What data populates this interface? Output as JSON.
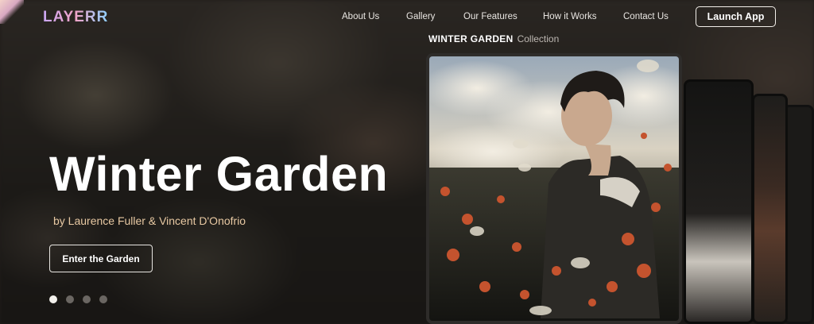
{
  "nav": {
    "logo": "LAYERR",
    "links": [
      "About Us",
      "Gallery",
      "Our Features",
      "How it Works",
      "Contact Us"
    ],
    "launch_label": "Launch App"
  },
  "hero": {
    "title": "Winter Garden",
    "subtitle": "by Laurence Fuller & Vincent D'Onofrio",
    "cta_label": "Enter the Garden",
    "slides": 4,
    "active_slide": 1
  },
  "collection": {
    "name": "WINTER GARDEN",
    "suffix": "Collection"
  },
  "colors": {
    "accent_subtitle": "#e8c9a3",
    "background": "#1f1c19",
    "logo_gradient": [
      "#c9a6f2",
      "#f0a3c8",
      "#8fd0ff"
    ]
  }
}
